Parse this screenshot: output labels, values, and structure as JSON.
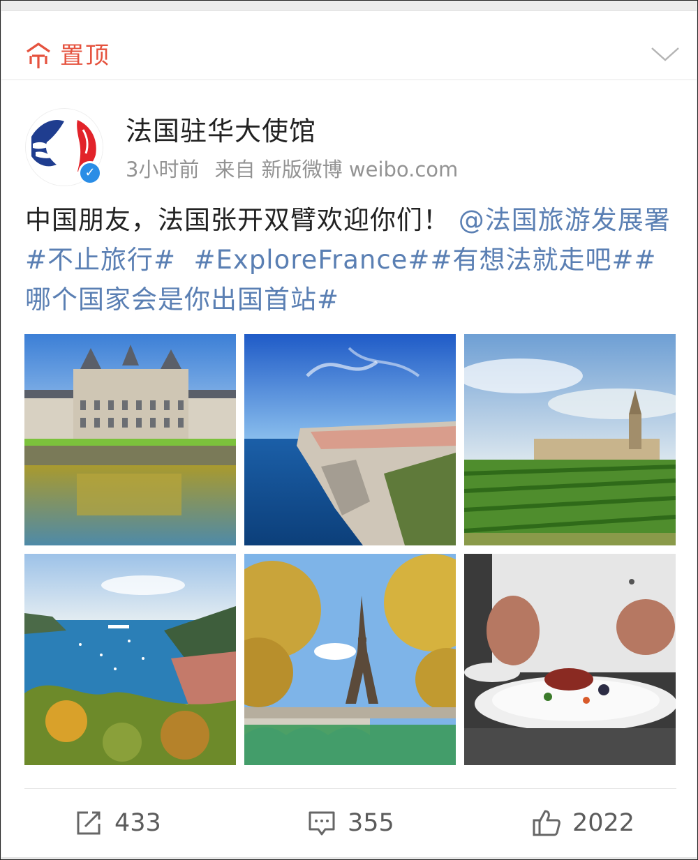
{
  "header": {
    "pin_label": "置顶",
    "pin_color": "#e5523e"
  },
  "post": {
    "user_name": "法国驻华大使馆",
    "time": "3小时前",
    "source": "来自 新版微博 weibo.com",
    "verified": true,
    "text_plain": "中国朋友，法国张开双臂欢迎你们！",
    "mention": "@法国旅游发展署",
    "tags": [
      "#不止旅行#",
      "#ExploreFrance#",
      "#有想法就走吧#",
      "#哪个国家会是你出国首站#"
    ],
    "link_color": "#5a7fb3"
  },
  "photos": [
    {
      "name": "photo-chateau",
      "subject": "château reflected in water"
    },
    {
      "name": "photo-cliffs",
      "subject": "seaside cliff town"
    },
    {
      "name": "photo-vineyard",
      "subject": "vineyard with church tower"
    },
    {
      "name": "photo-bay",
      "subject": "Mediterranean bay with boats"
    },
    {
      "name": "photo-eiffel",
      "subject": "Eiffel Tower over river"
    },
    {
      "name": "photo-chef",
      "subject": "chef plating a dish"
    }
  ],
  "actions": {
    "repost": {
      "icon": "share-icon",
      "count": "433"
    },
    "comment": {
      "icon": "comment-icon",
      "count": "355"
    },
    "like": {
      "icon": "thumbs-up-icon",
      "count": "2022"
    }
  }
}
